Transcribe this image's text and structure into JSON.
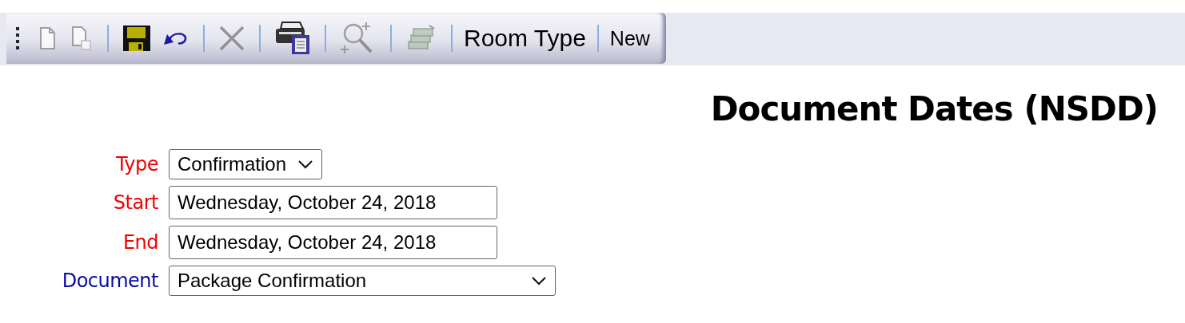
{
  "toolbar": {
    "groups": [
      [
        {
          "kind": "icon",
          "disabled": true
        },
        {
          "kind": "icon",
          "disabled": true
        }
      ],
      [
        {
          "kind": "icon",
          "disabled": false
        },
        {
          "kind": "icon",
          "disabled": false
        }
      ],
      [
        {
          "kind": "icon",
          "disabled": true
        }
      ],
      [
        {
          "kind": "icon",
          "disabled": false
        }
      ],
      [
        {
          "kind": "icon",
          "disabled": true
        }
      ],
      [
        {
          "kind": "icon",
          "disabled": true
        }
      ],
      [
        {
          "kind": "text",
          "label": "Room Type",
          "disabled": false
        }
      ],
      [
        {
          "kind": "text",
          "label": "New",
          "disabled": false
        }
      ]
    ]
  },
  "title": "Document Dates (NSDD)",
  "form": {
    "fields": [
      {
        "label": "Type",
        "required": true,
        "kind": "select",
        "value": "Confirmation"
      },
      {
        "label": "Start",
        "required": true,
        "kind": "date",
        "value": "Wednesday, October 24, 2018"
      },
      {
        "label": "End",
        "required": true,
        "kind": "date",
        "value": "Wednesday, October 24, 2018"
      },
      {
        "label": "Document",
        "required": false,
        "kind": "select",
        "value": "Package Confirmation"
      }
    ]
  }
}
